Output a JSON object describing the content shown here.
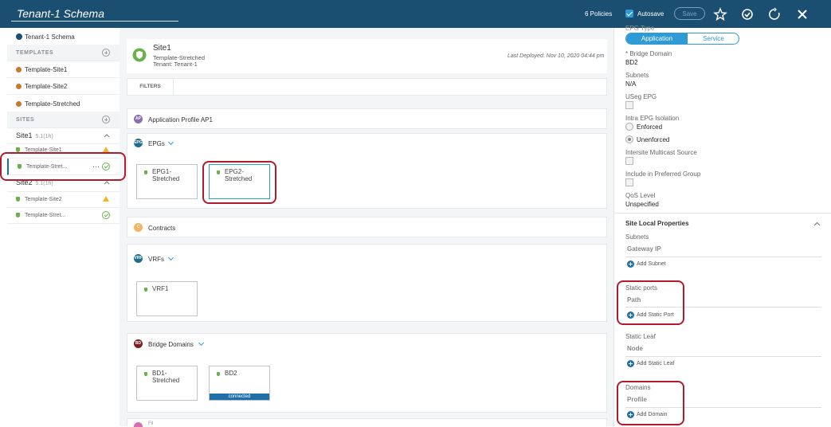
{
  "header": {
    "schema_title": "Tenant-1 Schema",
    "policies": "6 Policies",
    "autosave_label": "Autosave",
    "save_label": "Save"
  },
  "sidebar": {
    "schema_item": "Tenant-1 Schema",
    "templates_header": "TEMPLATES",
    "templates": [
      "Template-Site1",
      "Template-Site2",
      "Template-Stretched"
    ],
    "sites_header": "SITES",
    "site1": {
      "name": "Site1",
      "version": "5.1(1h)",
      "items": [
        "Template-Site1",
        "Template-Stret..."
      ]
    },
    "site2": {
      "name": "Site2",
      "version": "5.1(1h)",
      "items": [
        "Template-Site2",
        "Template-Stret..."
      ]
    },
    "more": "···"
  },
  "center": {
    "site_name": "Site1",
    "template": "Template-Stretched",
    "tenant": "Tenant: Tenant-1",
    "last_deployed": "Last Deployed: Nov 10, 2020 04:44 pm",
    "filters": "FILTERS",
    "app_profile": {
      "badge": "AP",
      "title": "Application Profile AP1"
    },
    "epgs": {
      "badge": "EPG",
      "title": "EPGs",
      "cards": [
        "EPG1-\nStretched",
        "EPG2-\nStretched"
      ]
    },
    "contracts": {
      "badge": "C",
      "title": "Contracts"
    },
    "vrfs": {
      "badge": "VRF",
      "title": "VRFs",
      "cards": [
        "VRF1"
      ]
    },
    "bds": {
      "badge": "BD",
      "title": "Bridge Domains",
      "cards": [
        "BD1-\nStretched",
        "BD2"
      ],
      "connected": "connected"
    },
    "bottom_partial": "Fil"
  },
  "right": {
    "epg_type": "EPG Type",
    "seg_application": "Application",
    "seg_service": "Service",
    "bd_label": "* Bridge Domain",
    "bd_value": "BD2",
    "subnets_label": "Subnets",
    "subnets_value": "N/A",
    "useg_label": "USeg EPG",
    "intra_label": "Intra EPG Isolation",
    "enforced": "Enforced",
    "unenforced": "Unenforced",
    "intersite_label": "Intersite Multicast Source",
    "preferred_label": "Include in Preferred Group",
    "qos_label": "QoS Level",
    "qos_value": "Unspecified",
    "site_local": "Site Local Properties",
    "subnets2": "Subnets",
    "gateway_ip": "Gateway IP",
    "add_subnet": "Add Subnet",
    "static_ports": "Static ports",
    "path": "Path",
    "add_static_port": "Add Static Port",
    "static_leaf": "Static Leaf",
    "node": "Node",
    "add_static_leaf": "Add Static Leaf",
    "domains": "Domains",
    "profile": "Profile",
    "add_domain": "Add Domain"
  },
  "colors": {
    "header": "#1b4f72",
    "accent": "#2e9bd6",
    "highlight": "#b01c2e"
  }
}
